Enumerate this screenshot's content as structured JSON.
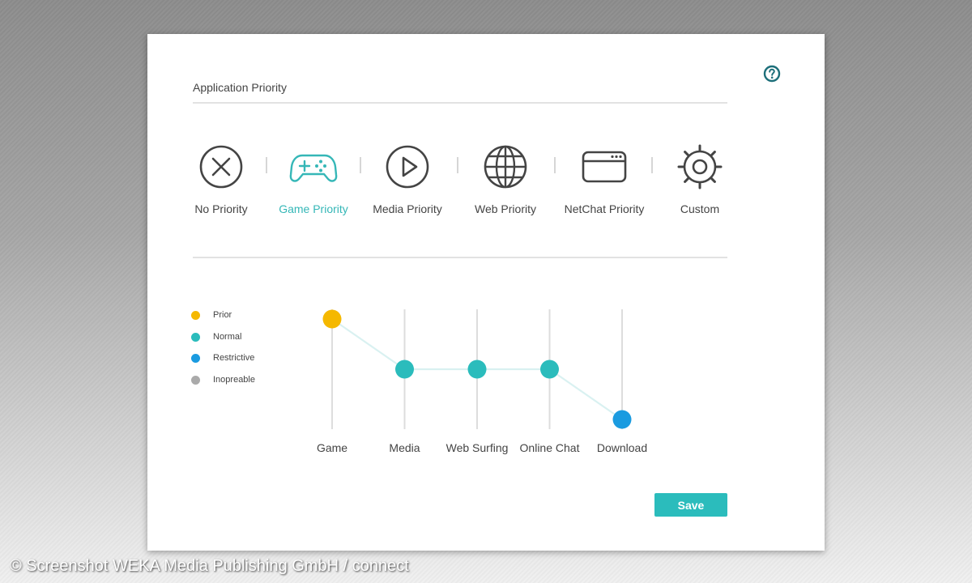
{
  "header": {
    "title": "Application Priority",
    "help_icon": "help-circle-icon"
  },
  "modes": [
    {
      "label": "No Priority",
      "icon": "close-circle-icon",
      "active": false
    },
    {
      "label": "Game Priority",
      "icon": "gamepad-icon",
      "active": true
    },
    {
      "label": "Media Priority",
      "icon": "play-circle-icon",
      "active": false
    },
    {
      "label": "Web Priority",
      "icon": "globe-icon",
      "active": false
    },
    {
      "label": "NetChat Priority",
      "icon": "chat-window-icon",
      "active": false
    },
    {
      "label": "Custom",
      "icon": "gear-icon",
      "active": false
    }
  ],
  "legend": [
    {
      "label": "Prior",
      "color": "#f5b800"
    },
    {
      "label": "Normal",
      "color": "#2bbcbc"
    },
    {
      "label": "Restrictive",
      "color": "#1a9be0"
    },
    {
      "label": "Inopreable",
      "color": "#aaaaaa"
    }
  ],
  "chart_data": {
    "type": "line",
    "categories": [
      "Game",
      "Media",
      "Web Surfing",
      "Online Chat",
      "Download"
    ],
    "levels": [
      "Prior",
      "Normal",
      "Restrictive"
    ],
    "values": [
      "Prior",
      "Normal",
      "Normal",
      "Normal",
      "Restrictive"
    ],
    "line_color": "#d9f1f1"
  },
  "actions": {
    "save_label": "Save"
  },
  "footer": {
    "copyright": "© Screenshot WEKA Media Publishing GmbH / connect"
  },
  "colors": {
    "accent": "#2bbcbc",
    "icon_default": "#444444",
    "text": "#444444"
  }
}
